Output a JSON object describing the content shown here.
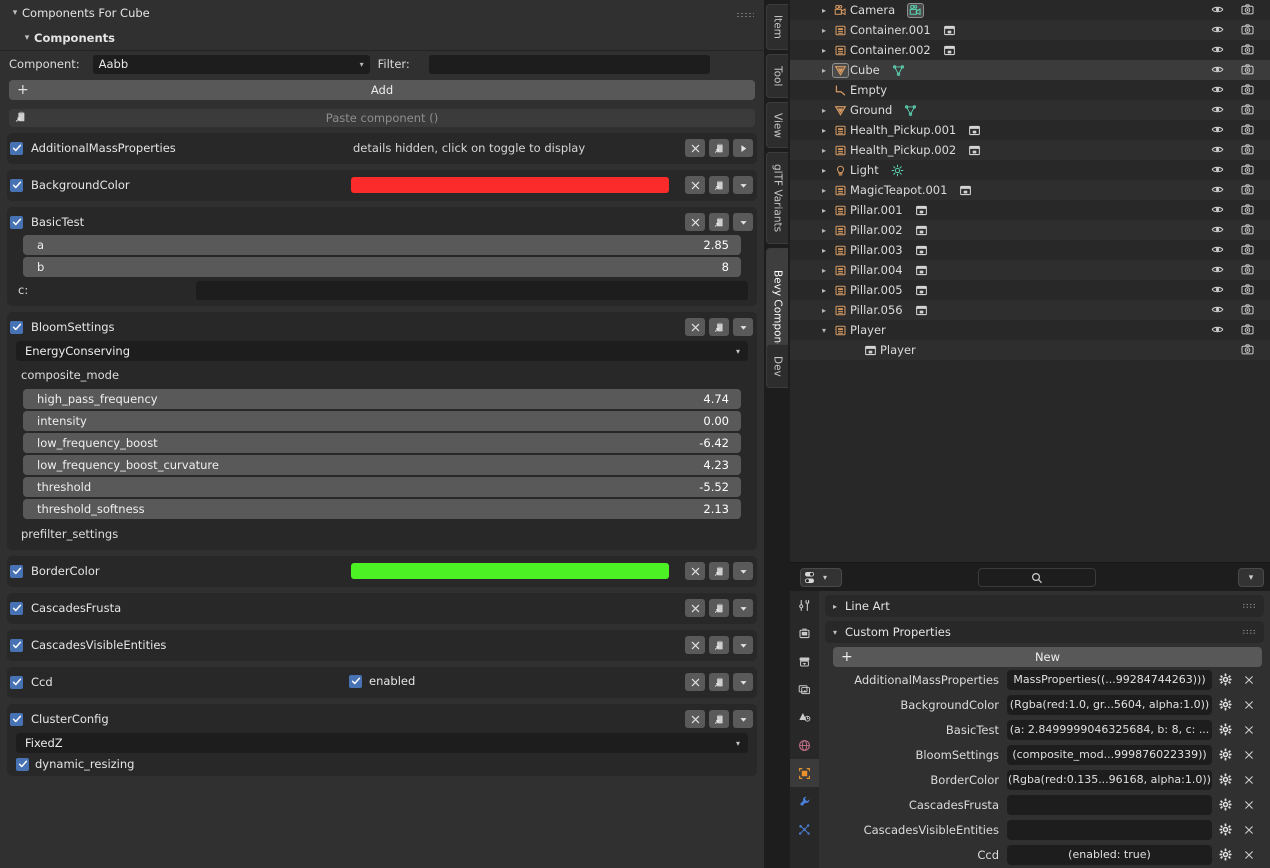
{
  "left_panel": {
    "header": "Components For Cube",
    "subheader": "Components",
    "component_label": "Component:",
    "component_value": "Aabb",
    "filter_label": "Filter:",
    "filter_value": "",
    "add_button": "Add",
    "paste_button": "Paste component ()",
    "components": [
      {
        "name": "AdditionalMassProperties",
        "checked": true,
        "hint": "details hidden, click on toggle to display",
        "last_icon": "play-icon"
      },
      {
        "name": "BackgroundColor",
        "checked": true,
        "swatch": "#fc2b2b",
        "last_icon": "chevron-down-icon"
      },
      {
        "name": "BasicTest",
        "checked": true,
        "last_icon": "chevron-down-icon",
        "sliders": [
          {
            "key": "a",
            "value": "2.85"
          },
          {
            "key": "b",
            "value": "8"
          }
        ],
        "text_field": {
          "key": "c:",
          "value": ""
        }
      },
      {
        "name": "BloomSettings",
        "checked": true,
        "last_icon": "chevron-down-icon",
        "enum_value": "EnergyConserving",
        "enum_caption": "composite_mode",
        "sliders": [
          {
            "key": "high_pass_frequency",
            "value": "4.74"
          },
          {
            "key": "intensity",
            "value": "0.00"
          },
          {
            "key": "low_frequency_boost",
            "value": "-6.42"
          },
          {
            "key": "low_frequency_boost_curvature",
            "value": "4.23"
          },
          {
            "key": "threshold",
            "value": "-5.52"
          },
          {
            "key": "threshold_softness",
            "value": "2.13"
          }
        ],
        "footer_caption": "prefilter_settings"
      },
      {
        "name": "BorderColor",
        "checked": true,
        "swatch": "#4cf224",
        "last_icon": "chevron-down-icon"
      },
      {
        "name": "CascadesFrusta",
        "checked": true,
        "last_icon": "chevron-down-icon"
      },
      {
        "name": "CascadesVisibleEntities",
        "checked": true,
        "last_icon": "chevron-down-icon"
      },
      {
        "name": "Ccd",
        "checked": true,
        "last_icon": "chevron-down-icon",
        "inline_check": {
          "label": "enabled",
          "checked": true
        }
      },
      {
        "name": "ClusterConfig",
        "checked": true,
        "last_icon": "chevron-down-icon",
        "enum_value": "FixedZ",
        "sub_check": {
          "label": "dynamic_resizing",
          "checked": true
        }
      }
    ],
    "row_buttons": {
      "clear": "close-icon",
      "copy": "paste-clipboard-icon"
    }
  },
  "tabstrip": {
    "tabs": [
      {
        "label": "Item",
        "active": false
      },
      {
        "label": "Tool",
        "active": false
      },
      {
        "label": "View",
        "active": false
      },
      {
        "label": "glTF Variants",
        "active": false
      },
      {
        "label": "Bevy Components",
        "active": true
      },
      {
        "label": "Dev",
        "active": false
      }
    ]
  },
  "outliner": {
    "rows": [
      {
        "name": "Camera",
        "icon": "camera-object-icon",
        "expandable": true,
        "indent": 0,
        "data_icon": "camera-data-icon",
        "data_highlight": true,
        "eye": true,
        "cam": true
      },
      {
        "name": "Container.001",
        "icon": "collection-instance-icon",
        "expandable": true,
        "indent": 0,
        "data_icon": "collection-icon",
        "eye": true,
        "cam": true
      },
      {
        "name": "Container.002",
        "icon": "collection-instance-icon",
        "expandable": true,
        "indent": 0,
        "data_icon": "collection-icon",
        "eye": true,
        "cam": true
      },
      {
        "name": "Cube",
        "icon": "mesh-object-icon",
        "expandable": true,
        "indent": 0,
        "data_icon": "mesh-data-icon",
        "selected": true,
        "icon_highlight": true,
        "eye": true,
        "cam": true
      },
      {
        "name": "Empty",
        "icon": "empty-axes-icon",
        "expandable": false,
        "indent": 0,
        "eye": true,
        "cam": true
      },
      {
        "name": "Ground",
        "icon": "mesh-object-icon",
        "expandable": true,
        "indent": 0,
        "data_icon": "mesh-data-icon",
        "eye": true,
        "cam": true
      },
      {
        "name": "Health_Pickup.001",
        "icon": "collection-instance-icon",
        "expandable": true,
        "indent": 0,
        "data_icon": "collection-icon",
        "eye": true,
        "cam": true
      },
      {
        "name": "Health_Pickup.002",
        "icon": "collection-instance-icon",
        "expandable": true,
        "indent": 0,
        "data_icon": "collection-icon",
        "eye": true,
        "cam": true
      },
      {
        "name": "Light",
        "icon": "light-object-icon",
        "expandable": true,
        "indent": 0,
        "data_icon": "light-data-icon",
        "eye": true,
        "cam": true
      },
      {
        "name": "MagicTeapot.001",
        "icon": "collection-instance-icon",
        "expandable": true,
        "indent": 0,
        "data_icon": "collection-icon",
        "eye": true,
        "cam": true
      },
      {
        "name": "Pillar.001",
        "icon": "collection-instance-icon",
        "expandable": true,
        "indent": 0,
        "data_icon": "collection-icon",
        "eye": true,
        "cam": true
      },
      {
        "name": "Pillar.002",
        "icon": "collection-instance-icon",
        "expandable": true,
        "indent": 0,
        "data_icon": "collection-icon",
        "eye": true,
        "cam": true
      },
      {
        "name": "Pillar.003",
        "icon": "collection-instance-icon",
        "expandable": true,
        "indent": 0,
        "data_icon": "collection-icon",
        "eye": true,
        "cam": true
      },
      {
        "name": "Pillar.004",
        "icon": "collection-instance-icon",
        "expandable": true,
        "indent": 0,
        "data_icon": "collection-icon",
        "eye": true,
        "cam": true
      },
      {
        "name": "Pillar.005",
        "icon": "collection-instance-icon",
        "expandable": true,
        "indent": 0,
        "data_icon": "collection-icon",
        "eye": true,
        "cam": true
      },
      {
        "name": "Pillar.056",
        "icon": "collection-instance-icon",
        "expandable": true,
        "indent": 0,
        "data_icon": "collection-icon",
        "eye": true,
        "cam": true
      },
      {
        "name": "Player",
        "icon": "collection-instance-icon",
        "expanded": true,
        "expandable": true,
        "indent": 0,
        "eye": true,
        "cam": true
      },
      {
        "name": "Player",
        "icon": "collection-icon",
        "expandable": false,
        "indent": 1,
        "eye": false,
        "cam": true
      }
    ]
  },
  "properties": {
    "header": {
      "editor_type": "editor-type-selector",
      "search_placeholder": "",
      "filter": "filter-dropdown"
    },
    "icon_tabs": [
      {
        "name": "tool-icon",
        "active": false
      },
      {
        "name": "render-icon",
        "active": false
      },
      {
        "name": "output-icon",
        "active": false
      },
      {
        "name": "view-layer-icon",
        "active": false
      },
      {
        "name": "scene-icon",
        "active": false
      },
      {
        "name": "world-icon",
        "active": false
      },
      {
        "name": "object-icon",
        "active": true
      },
      {
        "name": "modifier-wrench-icon",
        "active": false
      },
      {
        "name": "particles-icon",
        "active": false
      }
    ],
    "panels": [
      {
        "title": "Line Art",
        "expanded": false
      },
      {
        "title": "Custom Properties",
        "expanded": true
      }
    ],
    "new_button": "New",
    "custom_properties": [
      {
        "name": "AdditionalMassProperties",
        "value": "MassProperties((...99284744263)))"
      },
      {
        "name": "BackgroundColor",
        "value": "(Rgba(red:1.0, gr...5604, alpha:1.0))"
      },
      {
        "name": "BasicTest",
        "value": "(a: 2.8499999046325684, b: 8, c: ..."
      },
      {
        "name": "BloomSettings",
        "value": "(composite_mod...999876022339))"
      },
      {
        "name": "BorderColor",
        "value": "(Rgba(red:0.135...96168, alpha:1.0))"
      },
      {
        "name": "CascadesFrusta",
        "value": ""
      },
      {
        "name": "CascadesVisibleEntities",
        "value": ""
      },
      {
        "name": "Ccd",
        "value": "(enabled: true)"
      }
    ]
  }
}
